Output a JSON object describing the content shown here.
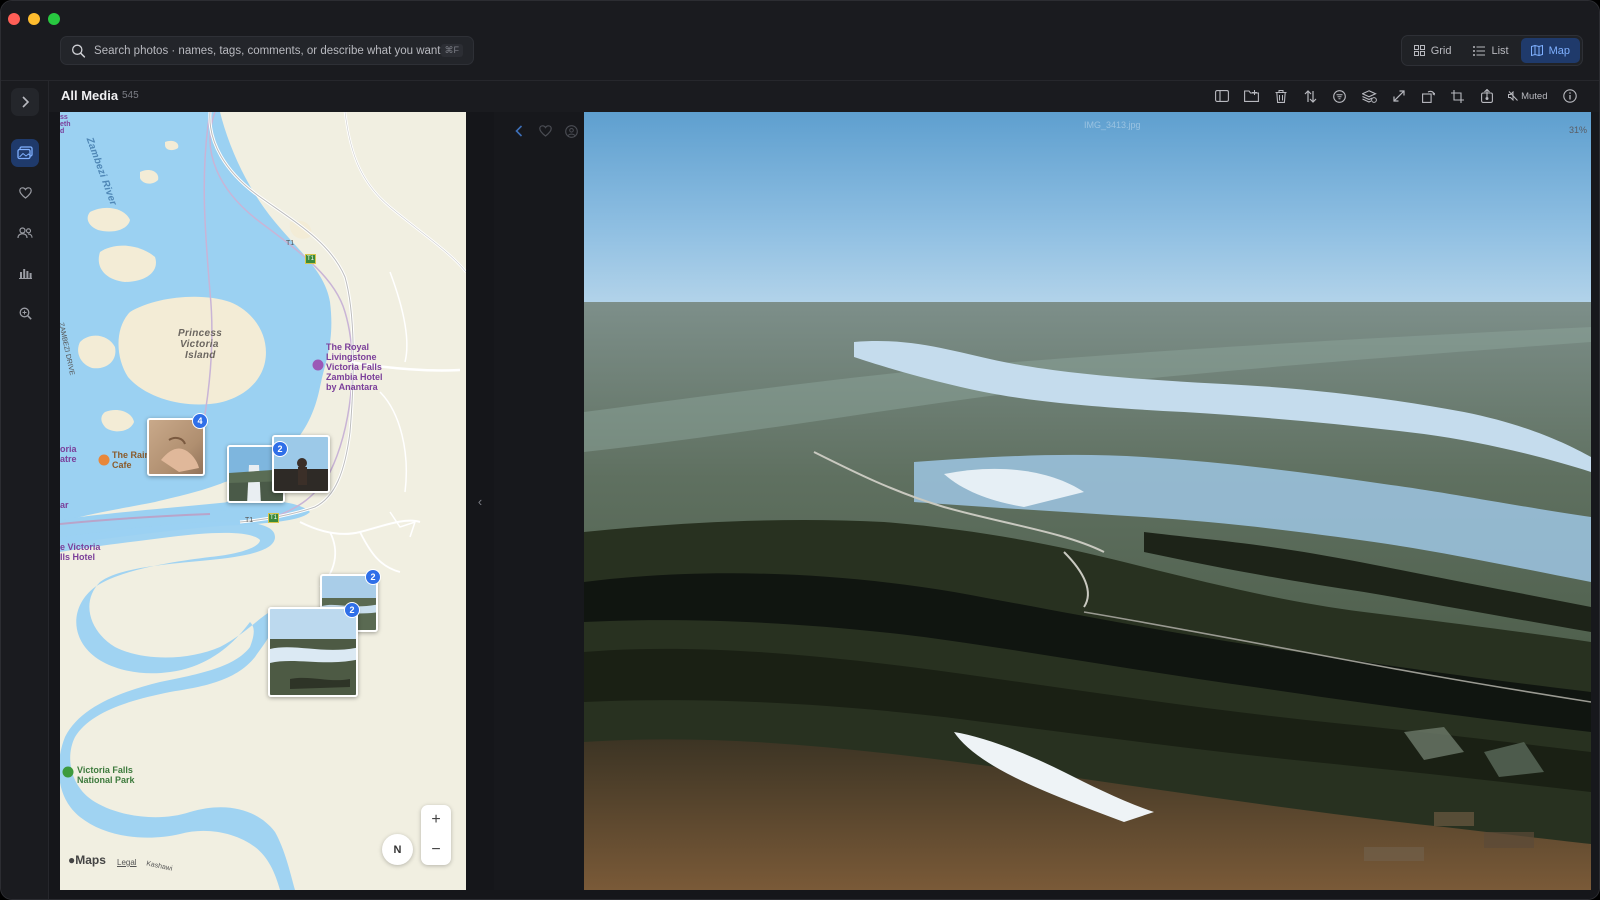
{
  "window": {
    "search_placeholder": "Search photos · names, tags, comments, or describe what you want",
    "search_shortcut": "⌘F"
  },
  "view_modes": [
    {
      "label": "Grid",
      "icon": "grid-icon",
      "active": false
    },
    {
      "label": "List",
      "icon": "list-icon",
      "active": false
    },
    {
      "label": "Map",
      "icon": "map-icon",
      "active": true
    }
  ],
  "sidebar": {
    "items": [
      {
        "name": "library",
        "icon": "photos-icon",
        "active": true
      },
      {
        "name": "favorites",
        "icon": "heart-icon",
        "active": false
      },
      {
        "name": "people",
        "icon": "people-icon",
        "active": false
      },
      {
        "name": "stats",
        "icon": "bar-chart-icon",
        "active": false
      },
      {
        "name": "search",
        "icon": "zoom-search-icon",
        "active": false
      }
    ]
  },
  "header": {
    "title": "All Media",
    "count": "545",
    "muted_label": "Muted"
  },
  "toolbar": {
    "icons": [
      "sidebar-toggle-icon",
      "add-folder-icon",
      "trash-icon",
      "sort-icon",
      "filter-icon",
      "layers-icon",
      "expand-icon",
      "rotate-left-icon",
      "crop-icon",
      "share-icon"
    ]
  },
  "map": {
    "labels": {
      "river": "Zambezi River",
      "island_1": "Princess",
      "island_2": "Victoria",
      "island_3": "Island",
      "drive": "ZAMBEZI DRIVE",
      "kashawi": "Kashawi"
    },
    "pois": {
      "royal_1": "The Royal",
      "royal_2": "Livingstone",
      "royal_3": "Victoria Falls",
      "royal_4": "Zambia Hotel",
      "royal_5": "by Anantara",
      "rain_1": "The Rain",
      "rain_2": "Cafe",
      "park_1": "Victoria Falls",
      "park_2": "National Park",
      "edge_1": "ss",
      "edge_2": "eth",
      "edge_3": "d",
      "edge_4": "oria",
      "edge_5": "atre",
      "edge_6": "ar",
      "edge_7": "e Victoria",
      "edge_8": "lls Hotel"
    },
    "roads": [
      "T1",
      "T1"
    ],
    "route_shields": [
      "T1",
      "T1"
    ],
    "clusters": [
      {
        "count": "4"
      },
      {
        "count": "2"
      },
      {
        "count": "2"
      },
      {
        "count": "2"
      }
    ],
    "zoom_in": "+",
    "zoom_out": "−",
    "compass": "N",
    "brand": "Maps",
    "legal": "Legal"
  },
  "viewer": {
    "filename": "IMG_3413.jpg",
    "zoom": "31%",
    "collapse_icon": "‹"
  },
  "colors": {
    "accent": "#2f6fe8",
    "active_bg": "#1f3a6b",
    "water": "#9bd1f2"
  }
}
